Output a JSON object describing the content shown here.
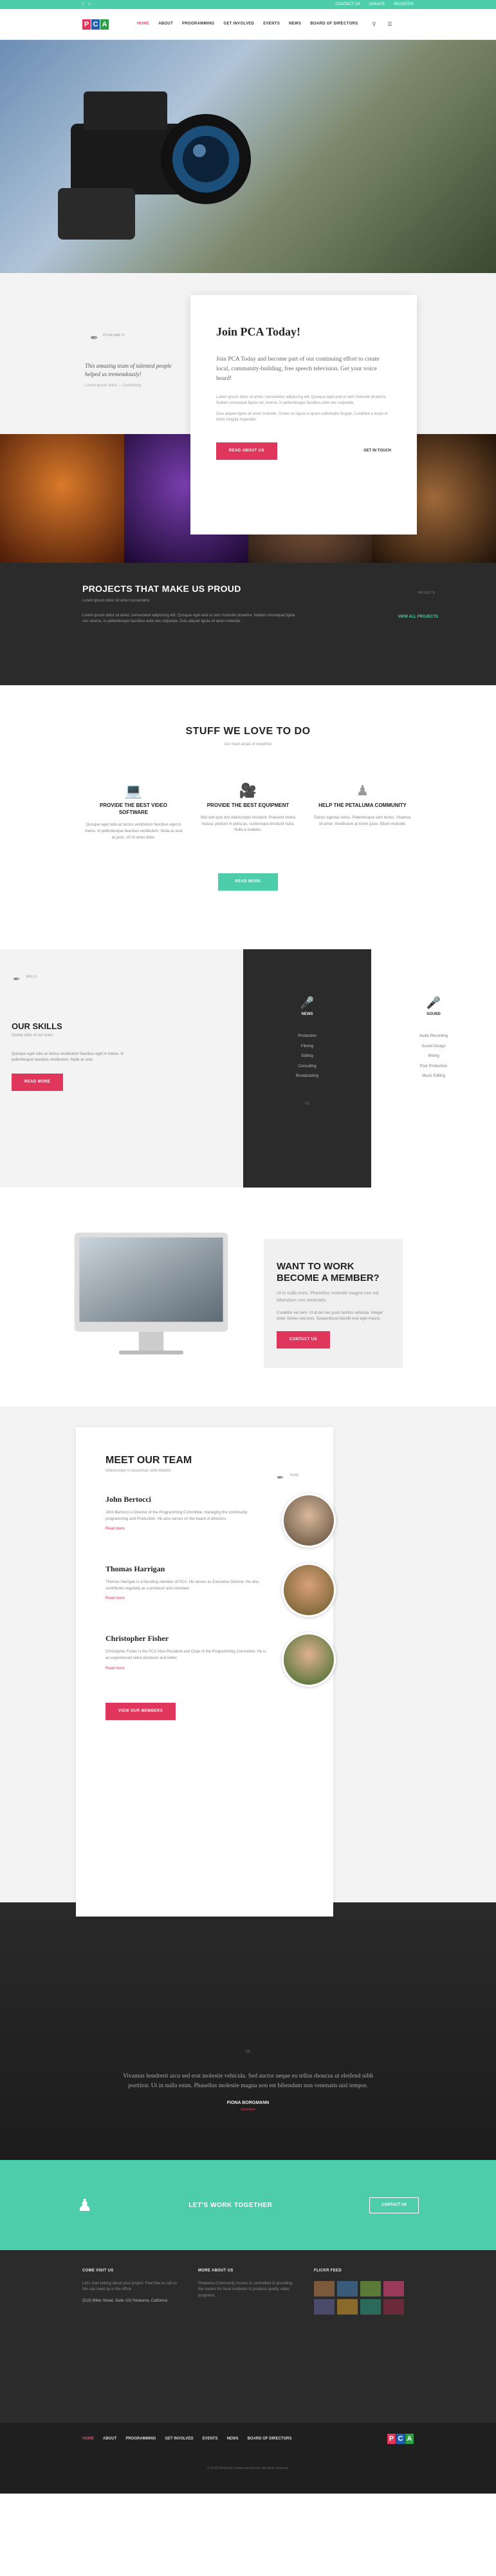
{
  "topbar": {
    "left_icons": [
      "f",
      "t"
    ],
    "contact": "CONTACT US",
    "donate": "DONATE",
    "user": "REGISTER"
  },
  "nav": {
    "logo": [
      "P",
      "C",
      "A"
    ],
    "items": [
      {
        "label": "HOME",
        "active": true
      },
      {
        "label": "ABOUT"
      },
      {
        "label": "PROGRAMMING"
      },
      {
        "label": "GET INVOLVED"
      },
      {
        "label": "EVENTS"
      },
      {
        "label": "NEWS"
      },
      {
        "label": "BOARD OF DIRECTORS"
      }
    ],
    "icons": [
      "search-icon",
      "cart-icon"
    ]
  },
  "join": {
    "pen_label": "PETALUMA TV",
    "quote": "This amazing team of talented people helped us tremendously!",
    "quote_by": "Lorem ipsum dolor — Somebody",
    "title": "Join PCA Today!",
    "lead": "Join PCA Today and become part of our continuing effort to create local, community-building, free speech television. Get your voice heard!",
    "small1": "Lorem ipsum dolor sit amet, consectetur adipiscing elit. Quisque eget erat ut sem molestie pharetra. Nullam consequat ligula nec viverra. In pellentesque faucibus ante nec vulputate.",
    "small2": "Duis aliquet ligula sit amet molestie. Donec eu ligula ut quam sollicitudin feugiat. Curabitur a turpis et tortor fringilla imperdiet.",
    "btn1": "READ ABOUT US",
    "btn2": "GET IN TOUCH"
  },
  "projects": {
    "title": "PROJECTS THAT MAKE US PROUD",
    "sub": "Lorem ipsum dolor sit amet consectetur",
    "text": "Lorem ipsum dolor sit amet, consectetur adipiscing elit. Quisque eget erat ut sem molestie pharetra. Nullam consequat ligula nec viverra. In pellentesque faucibus ante nec vulputate. Duis aliquet ligula sit amet molestie.",
    "tag": "PROJECTS",
    "view": "VIEW ALL PROJECTS"
  },
  "stuff": {
    "title": "STUFF WE LOVE TO DO",
    "sub": "Our main areas of expertise",
    "cols": [
      {
        "icon": "laptop-icon",
        "title": "PROVIDE THE BEST VIDEO SOFTWARE",
        "text": "Quisque eget odio ac lectus vestibulum faucibus eget in metus. In pellentesque faucibus vestibulum. Nulla ac erat at justo. Ut sit amet dolor."
      },
      {
        "icon": "camera-icon",
        "title": "PROVIDE THE BEST EQUIPMENT",
        "text": "Sed sed quis orci ullamcorper tincidunt. Praesent metus massa, pretium in porta ac, scelerisque tincidunt nulla. Nulla a sodales."
      },
      {
        "icon": "people-icon",
        "title": "HELP THE PETALUMA COMMUNITY",
        "text": "Donec egestas tellus. Pellentesque sem lectus. Vivamus sit amet. Vestibulum at lorem justo. Etiam molestie."
      }
    ],
    "btn": "READ MORE"
  },
  "skills": {
    "tag": "SKILLS",
    "title": "OUR SKILLS",
    "sub": "Global skills of our team",
    "text": "Quisque eget odio ac lectus vestibulum faucibus eget in metus. In pellentesque faucibus vestibulum. Nulla ac erat.",
    "btn": "READ MORE",
    "mid_title": "NEWS",
    "mid_items": [
      "Production",
      "Filming",
      "Editing",
      "Consulting",
      "Broadcasting"
    ],
    "mid_counter": "01",
    "rt_title": "SOUND",
    "rt_items": [
      "Audio Recording",
      "Sound Design",
      "Mixing",
      "Post Production",
      "Music Editing"
    ]
  },
  "member": {
    "title": "WANT TO WORK BECOME A MEMBER?",
    "lead": "Ut in nulla enim. Phasellus molestie magna non est bibendum non venenatis.",
    "text": "Curabitur vel sem. Ut at dui nec justo facilisis vehicula. Integer dolor. Donec sed eros. Suspendisse blandit erat eget mauris.",
    "btn": "CONTACT US"
  },
  "team": {
    "tag": "TEAM",
    "title": "MEET OUR TEAM",
    "sub": "Ullamcorper in accumsan ante lobortis",
    "people": [
      {
        "name": "John Bertocci",
        "text": "John Bertocci is Director of the Programming Committee, managing the community programming and Production. He also serves on the board of directors.",
        "more": "Read more"
      },
      {
        "name": "Thomas Harrigan",
        "text": "Thomas Harrigan is a founding member of PCA. He serves as Executive Director. He also contributes regularly as a producer and volunteer.",
        "more": "Read more"
      },
      {
        "name": "Christopher Fisher",
        "text": "Christopher Fisher is the PCA Vice-President and Chair of the Programming Committee. He is an experienced video producer and editor.",
        "more": "Read more"
      }
    ],
    "btn": "VIEW OUR MEMBERS"
  },
  "testimonial": {
    "text": "Vivamus hendrerit arcu sed erat molestie vehicula. Sed auctor neque eu tellus rhoncus ut eleifend nibh porttitor. Ut in nulla enim. Phasellus molestie magna non est bibendum non venenatis nisl tempor.",
    "name": "FIONA BORGMANN",
    "role": "Volunteer"
  },
  "together": {
    "title": "LET'S WORK TOGETHER",
    "btn": "CONTACT US"
  },
  "footer": {
    "c1_title": "COME VISIT US",
    "c1_text": "Let's start talking about your project. Feel free to call us. We can meet up in the office.",
    "c1_addr": "(510) Miller Street, Suite 102 Petaluma, California",
    "c2_title": "MORE ABOUT US",
    "c2_text": "Petaluma Community Access is committed to providing the means for local residents to produce quality video programs.",
    "c3_title": "FLICKR FEED"
  },
  "bottom_nav": {
    "items": [
      {
        "label": "HOME",
        "active": true
      },
      {
        "label": "ABOUT"
      },
      {
        "label": "PROGRAMMING"
      },
      {
        "label": "GET INVOLVED"
      },
      {
        "label": "EVENTS"
      },
      {
        "label": "NEWS"
      },
      {
        "label": "BOARD OF DIRECTORS"
      }
    ]
  },
  "copyright": "© 2015 Petaluma Community Access. All rights reserved.",
  "colors": {
    "accent_green": "#4ecdaa",
    "accent_red": "#e0365b",
    "dark": "#2b2b2b"
  }
}
